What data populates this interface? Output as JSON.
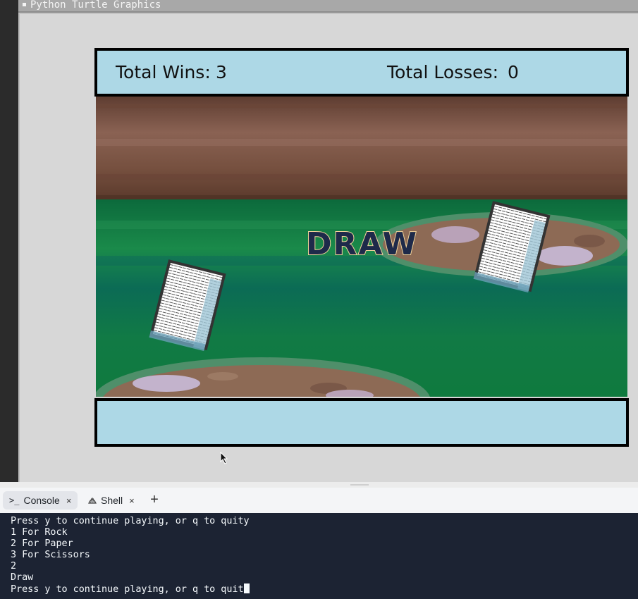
{
  "window": {
    "title": "Python Turtle Graphics"
  },
  "scoreboard": {
    "wins_label": "Total Wins:",
    "wins_value": "3",
    "losses_label": "Total Losses:",
    "losses_value": "0"
  },
  "result": {
    "text": "DRAW"
  },
  "hands": {
    "player": "paper-icon",
    "computer": "paper-icon"
  },
  "tabs": [
    {
      "label": "Console",
      "icon": "terminal-icon",
      "active": true
    },
    {
      "label": "Shell",
      "icon": "shell-icon",
      "active": false
    }
  ],
  "console": {
    "lines": [
      "Press y to continue playing, or q to quity",
      "1 For Rock",
      "2 For Paper",
      "3 For Scissors",
      "2",
      "Draw",
      "Press y to continue playing, or q to quit"
    ]
  },
  "colors": {
    "panel_bg": "#add8e6",
    "console_bg": "#1c2333",
    "grass": "#0e7a43",
    "wall": "#7a5444"
  }
}
